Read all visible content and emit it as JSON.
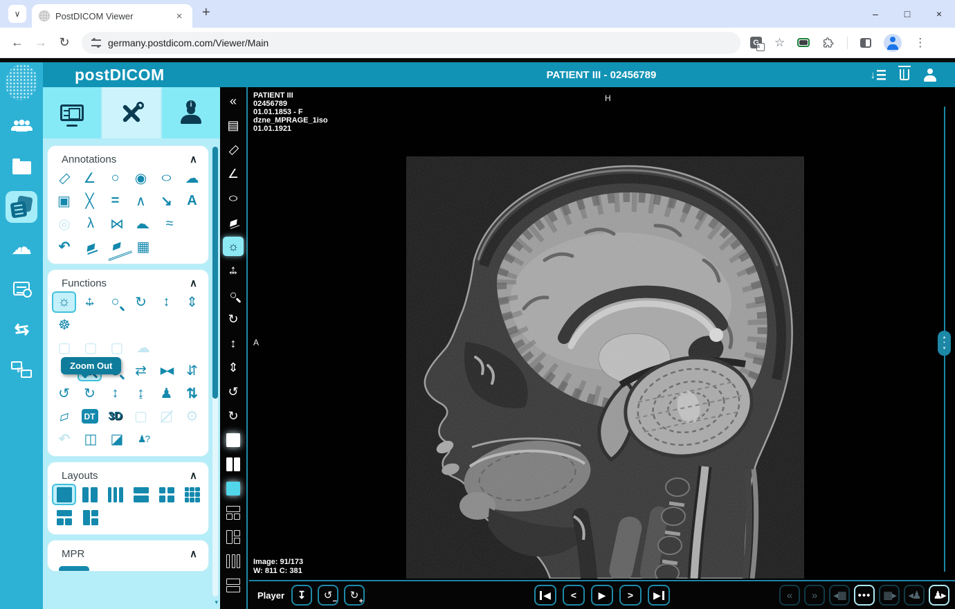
{
  "browser": {
    "tab_title": "PostDICOM Viewer",
    "url": "germany.postdicom.com/Viewer/Main",
    "window_controls": [
      "minimize",
      "maximize",
      "close"
    ]
  },
  "header": {
    "logo": "postDICOM",
    "title": "PATIENT III - 02456789",
    "right_icons": [
      "sort-list-icon",
      "recycle-bin-icon",
      "user-icon"
    ]
  },
  "sidebar": {
    "items": [
      "patients",
      "folders",
      "studies",
      "cloud-upload",
      "worklist",
      "sync",
      "share"
    ]
  },
  "panel": {
    "tabs": [
      "viewer-tab",
      "tools-tab",
      "patient-info-tab"
    ],
    "annotations": {
      "title": "Annotations",
      "icons": [
        [
          {
            "name": "ruler-icon"
          },
          {
            "name": "angle-icon"
          },
          {
            "name": "circle-icon"
          },
          {
            "name": "hatched-circle-icon"
          },
          {
            "name": "ellipse-icon"
          },
          {
            "name": "freehand-icon"
          }
        ],
        [
          {
            "name": "rect-roi-icon"
          },
          {
            "name": "cobb-angle-icon"
          },
          {
            "name": "parallel-lines-icon"
          },
          {
            "name": "polyline-icon"
          },
          {
            "name": "arrow-icon"
          },
          {
            "name": "text-icon"
          }
        ],
        [
          {
            "name": "probe-icon",
            "state": "disabled"
          },
          {
            "name": "angle-lines-icon"
          },
          {
            "name": "spline-roi-icon"
          },
          {
            "name": "closed-freehand-icon"
          },
          {
            "name": "wave-icon"
          }
        ],
        [
          {
            "name": "undo-icon"
          },
          {
            "name": "eraser-icon"
          },
          {
            "name": "eraser-all-icon"
          },
          {
            "name": "save-annotation-icon"
          }
        ]
      ]
    },
    "functions": {
      "title": "Functions",
      "tooltip": "Zoom Out",
      "icons": [
        [
          {
            "name": "window-level-icon",
            "state": "selected"
          },
          {
            "name": "pan-icon"
          },
          {
            "name": "search-icon"
          },
          {
            "name": "rotate-icon"
          },
          {
            "name": "scroll-icon"
          },
          {
            "name": "stack-scroll-icon"
          }
        ],
        [
          {
            "name": "localizer-icon"
          }
        ],
        [
          {
            "name": "hidden-tool-icon",
            "state": "disabled"
          },
          {
            "name": "hidden-tool-icon",
            "state": "disabled"
          },
          {
            "name": "hidden-tool-icon",
            "state": "disabled"
          },
          {
            "name": "freehand-3d-icon",
            "state": "disabled"
          }
        ],
        [
          {
            "name": "invert-icon"
          },
          {
            "name": "zoom-out-icon",
            "state": "selected"
          },
          {
            "name": "zoom-in-icon"
          },
          {
            "name": "flip-horizontal-icon"
          },
          {
            "name": "mirror-horizontal-icon"
          },
          {
            "name": "mirror-vertical-icon"
          }
        ],
        [
          {
            "name": "rotate-gear-icon"
          },
          {
            "name": "auto-rotate-icon"
          },
          {
            "name": "expand-vertical-icon"
          },
          {
            "name": "collapse-vertical-icon"
          },
          {
            "name": "patient-orientation-icon"
          },
          {
            "name": "swap-scroll-icon"
          }
        ],
        [
          {
            "name": "tag-icon"
          },
          {
            "name": "dt-icon"
          },
          {
            "name": "3d-icon"
          },
          {
            "name": "select-region-icon",
            "state": "disabled"
          },
          {
            "name": "clear-region-icon",
            "state": "disabled"
          },
          {
            "name": "repair-icon",
            "state": "disabled"
          }
        ],
        [
          {
            "name": "undo-icon",
            "state": "disabled"
          },
          {
            "name": "image-history-icon"
          },
          {
            "name": "image-lock-icon"
          },
          {
            "name": "ask-icon"
          }
        ]
      ]
    },
    "layouts": {
      "title": "Layouts",
      "icons": [
        [
          {
            "name": "layout-single-icon",
            "state": "selected"
          },
          {
            "name": "layout-2col-icon"
          },
          {
            "name": "layout-3col-icon"
          },
          {
            "name": "layout-2row-icon"
          },
          {
            "name": "layout-2x2-icon"
          },
          {
            "name": "layout-3x3-icon"
          }
        ],
        [
          {
            "name": "layout-1top2-icon"
          },
          {
            "name": "layout-1left2-icon"
          }
        ]
      ]
    },
    "mpr": {
      "title": "MPR"
    }
  },
  "toolbar": {
    "items": [
      {
        "name": "collapse-panel-icon"
      },
      {
        "name": "report-icon"
      },
      {
        "name": "ruler-icon"
      },
      {
        "name": "angle-icon"
      },
      {
        "name": "ellipse-icon"
      },
      {
        "name": "eraser-icon"
      },
      {
        "name": "window-level-icon",
        "state": "selected"
      },
      {
        "name": "pan-icon"
      },
      {
        "name": "search-icon"
      },
      {
        "name": "rotate-icon"
      },
      {
        "name": "scroll-icon"
      },
      {
        "name": "stack-scroll-icon"
      },
      {
        "name": "rotate-gear-icon"
      },
      {
        "name": "auto-rotate-icon"
      },
      {
        "name": "layout-single-filled-icon"
      },
      {
        "name": "layout-2col-filled-icon"
      },
      {
        "name": "layout-single-active-icon"
      },
      {
        "name": "layout-1top2-outline-icon"
      },
      {
        "name": "layout-1left2-outline-icon"
      },
      {
        "name": "layout-3col-outline-icon"
      },
      {
        "name": "layout-2row-outline-icon"
      }
    ]
  },
  "viewer": {
    "overlay": {
      "lines": [
        "PATIENT III",
        "02456789",
        "01.01.1853 - F",
        "dzne_MPRAGE_1iso",
        "01.01.1921"
      ],
      "orientation_top": "H",
      "orientation_left": "A",
      "image_counter": "Image: 91/173",
      "window_level": "W: 811 C: 381"
    }
  },
  "player": {
    "label": "Player",
    "left": [
      {
        "name": "download-icon"
      },
      {
        "name": "speed-down-icon"
      },
      {
        "name": "speed-up-icon"
      }
    ],
    "transport": [
      {
        "name": "first-frame-icon"
      },
      {
        "name": "prev-frame-icon"
      },
      {
        "name": "play-icon"
      },
      {
        "name": "next-frame-icon"
      },
      {
        "name": "last-frame-icon"
      }
    ],
    "right": [
      {
        "name": "jump-back-icon",
        "state": "disabled"
      },
      {
        "name": "jump-fwd-icon",
        "state": "disabled"
      },
      {
        "name": "grid-prev-icon",
        "state": "disabled"
      },
      {
        "name": "more-icon",
        "state": "active"
      },
      {
        "name": "grid-next-icon",
        "state": "disabled"
      },
      {
        "name": "patient-prev-icon",
        "state": "disabled"
      },
      {
        "name": "patient-next-icon",
        "state": "active"
      }
    ]
  },
  "colors": {
    "appbar_teal": "#1193b5",
    "sidebar_teal": "#2db2d6",
    "panel_bg": "#b5edf8",
    "icon_teal": "#1489ad",
    "tooltip_bg": "#0f7c9b",
    "player_border": "#1d87a6",
    "viewer_bg": "#010101"
  }
}
